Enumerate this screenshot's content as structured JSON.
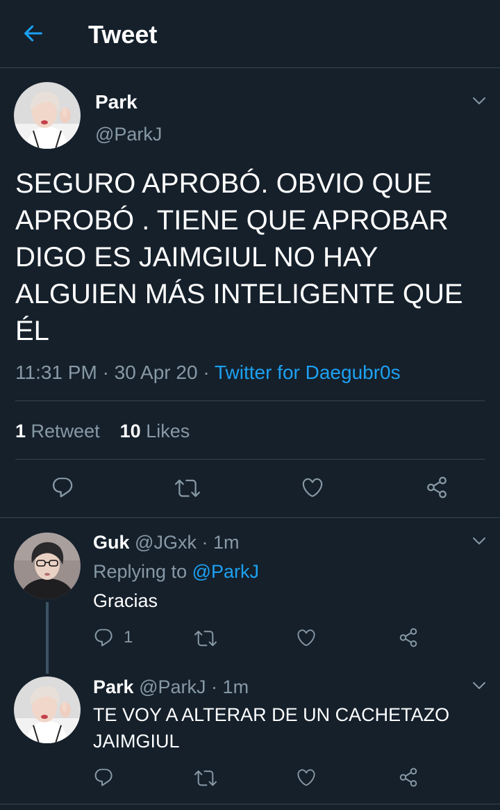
{
  "header": {
    "title": "Tweet"
  },
  "tweet": {
    "name": "Park",
    "handle": "@ParkJ",
    "text": "SEGURO APROBÓ. OBVIO QUE APROBÓ . TIENE QUE APROBAR DIGO ES JAIMGIUL NO HAY ALGUIEN MÁS INTELIGENTE QUE ÉL",
    "time": "11:31 PM",
    "date": "30 Apr 20",
    "separator": "·",
    "source": "Twitter for Daegubr0s",
    "retweets_count": "1",
    "retweets_label": "Retweet",
    "likes_count": "10",
    "likes_label": "Likes"
  },
  "replies": [
    {
      "name": "Guk",
      "handle": "@JGxk",
      "separator": "·",
      "time": "1m",
      "replying_prefix": "Replying to",
      "replying_to": "@ParkJ",
      "text": "Gracias",
      "reply_count": "1"
    },
    {
      "name": "Park",
      "handle": "@ParkJ",
      "separator": "·",
      "time": "1m",
      "text": "TE VOY A ALTERAR DE UN CACHETAZO JAIMGIUL"
    }
  ],
  "colors": {
    "background": "#15202b",
    "accent": "#1da1f2",
    "secondary_text": "#8899a6",
    "divider": "#38444d"
  },
  "icons": {
    "back": "arrow-left-icon",
    "menu": "chevron-down-icon",
    "reply": "reply-icon",
    "retweet": "retweet-icon",
    "like": "heart-icon",
    "share": "share-icon"
  }
}
